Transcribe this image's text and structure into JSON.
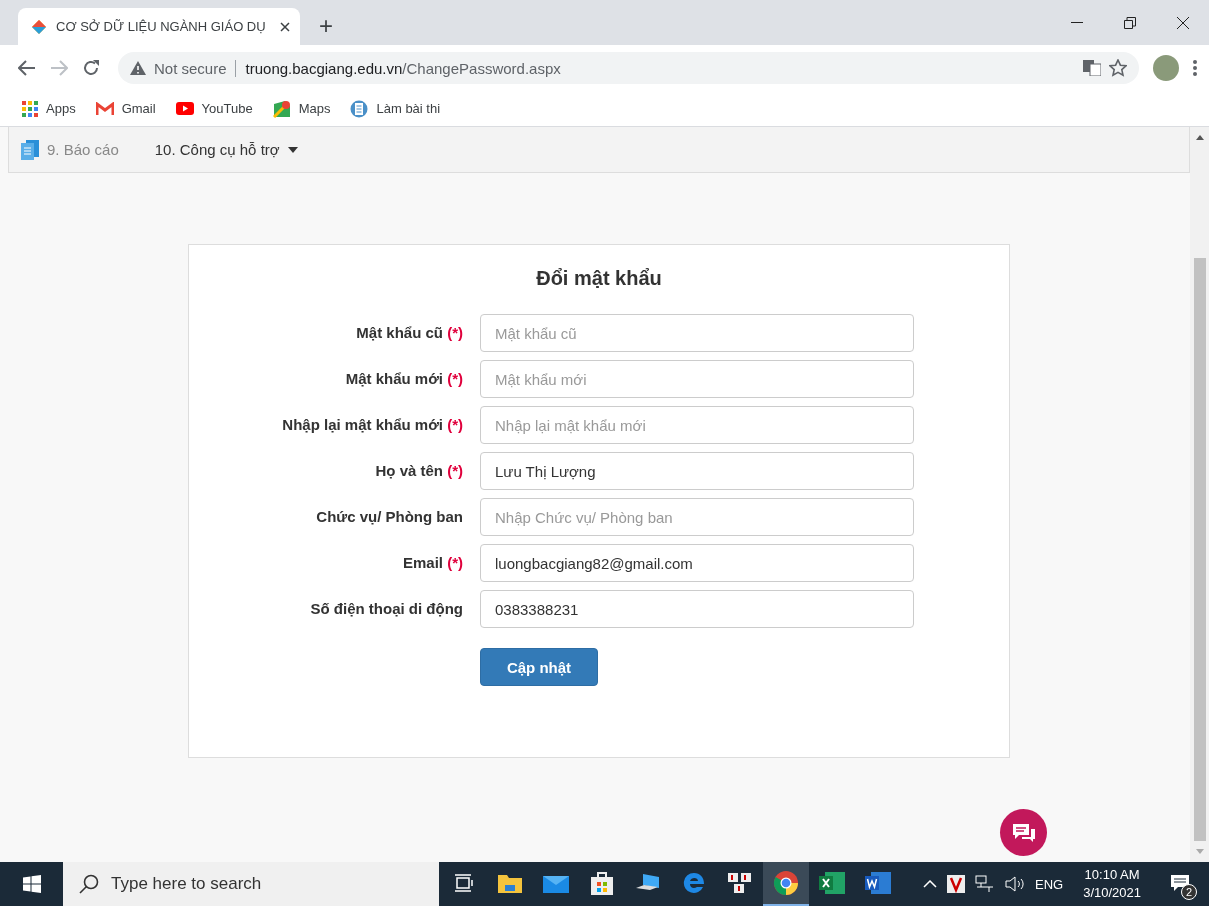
{
  "browser": {
    "tab": {
      "title": "CƠ SỞ DỮ LIỆU NGÀNH GIÁO DỤ",
      "selected": true
    },
    "new_tab": "+",
    "address": {
      "security": "Not secure",
      "domain": "truong.bacgiang.edu.vn",
      "path": "/ChangePassword.aspx"
    },
    "bookmarks": [
      {
        "label": "Apps"
      },
      {
        "label": "Gmail"
      },
      {
        "label": "YouTube"
      },
      {
        "label": "Maps"
      },
      {
        "label": "Làm bài thi"
      }
    ]
  },
  "nav": [
    {
      "label": "9. Báo cáo",
      "selected": false,
      "kind": "icon_link"
    },
    {
      "label": "10. Công cụ hỗ trợ",
      "selected": true,
      "kind": "dropdown"
    }
  ],
  "form": {
    "title": "Đổi mật khẩu",
    "fields": [
      {
        "label": "Mật khẩu cũ",
        "required_mark": "(*)",
        "placeholder": "Mật khẩu cũ"
      },
      {
        "label": "Mật khẩu mới",
        "required_mark": "(*)",
        "placeholder": "Mật khẩu mới"
      },
      {
        "label": "Nhập lại mật khẩu mới",
        "required_mark": "(*)",
        "placeholder": "Nhập lại mật khẩu mới"
      },
      {
        "label": "Họ và tên",
        "required_mark": "(*)",
        "value": "Lưu Thị Lượng"
      },
      {
        "label": "Chức vụ/ Phòng ban",
        "placeholder": "Nhập Chức vụ/ Phòng ban"
      },
      {
        "label": "Email",
        "required_mark": "(*)",
        "value": "luongbacgiang82@gmail.com"
      },
      {
        "label": "Số điện thoại di động",
        "value": "0383388231"
      }
    ],
    "submit": "Cập nhật"
  },
  "taskbar": {
    "search_placeholder": "Type here to search",
    "apps": [
      {
        "kind": "taskview",
        "active": false
      },
      {
        "kind": "folder",
        "active": false
      },
      {
        "kind": "mail",
        "active": false
      },
      {
        "kind": "store",
        "active": false
      },
      {
        "kind": "pc",
        "active": false
      },
      {
        "kind": "edge",
        "active": false
      },
      {
        "kind": "unikey",
        "active": false
      },
      {
        "kind": "chrome",
        "active": true
      },
      {
        "kind": "excel",
        "active": false
      },
      {
        "kind": "word",
        "active": false
      }
    ],
    "language": "ENG",
    "time": "10:10 AM",
    "date": "3/10/2021",
    "notifications": "2"
  }
}
